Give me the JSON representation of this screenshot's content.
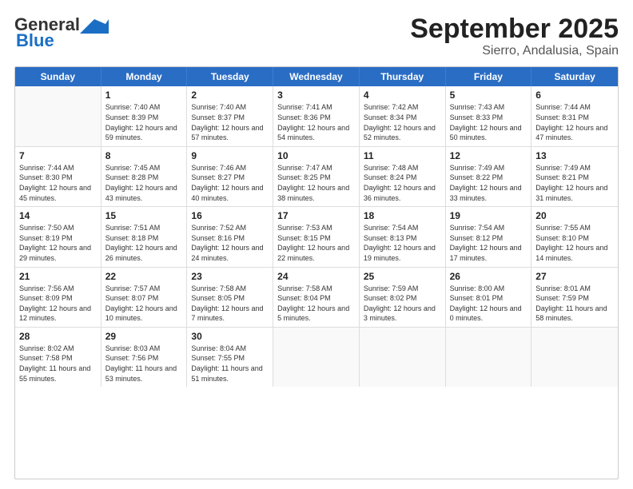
{
  "header": {
    "logo_general": "General",
    "logo_blue": "Blue",
    "title": "September 2025",
    "subtitle": "Sierro, Andalusia, Spain"
  },
  "weekdays": [
    "Sunday",
    "Monday",
    "Tuesday",
    "Wednesday",
    "Thursday",
    "Friday",
    "Saturday"
  ],
  "weeks": [
    [
      {
        "day": "",
        "sunrise": "",
        "sunset": "",
        "daylight": ""
      },
      {
        "day": "1",
        "sunrise": "Sunrise: 7:40 AM",
        "sunset": "Sunset: 8:39 PM",
        "daylight": "Daylight: 12 hours and 59 minutes."
      },
      {
        "day": "2",
        "sunrise": "Sunrise: 7:40 AM",
        "sunset": "Sunset: 8:37 PM",
        "daylight": "Daylight: 12 hours and 57 minutes."
      },
      {
        "day": "3",
        "sunrise": "Sunrise: 7:41 AM",
        "sunset": "Sunset: 8:36 PM",
        "daylight": "Daylight: 12 hours and 54 minutes."
      },
      {
        "day": "4",
        "sunrise": "Sunrise: 7:42 AM",
        "sunset": "Sunset: 8:34 PM",
        "daylight": "Daylight: 12 hours and 52 minutes."
      },
      {
        "day": "5",
        "sunrise": "Sunrise: 7:43 AM",
        "sunset": "Sunset: 8:33 PM",
        "daylight": "Daylight: 12 hours and 50 minutes."
      },
      {
        "day": "6",
        "sunrise": "Sunrise: 7:44 AM",
        "sunset": "Sunset: 8:31 PM",
        "daylight": "Daylight: 12 hours and 47 minutes."
      }
    ],
    [
      {
        "day": "7",
        "sunrise": "Sunrise: 7:44 AM",
        "sunset": "Sunset: 8:30 PM",
        "daylight": "Daylight: 12 hours and 45 minutes."
      },
      {
        "day": "8",
        "sunrise": "Sunrise: 7:45 AM",
        "sunset": "Sunset: 8:28 PM",
        "daylight": "Daylight: 12 hours and 43 minutes."
      },
      {
        "day": "9",
        "sunrise": "Sunrise: 7:46 AM",
        "sunset": "Sunset: 8:27 PM",
        "daylight": "Daylight: 12 hours and 40 minutes."
      },
      {
        "day": "10",
        "sunrise": "Sunrise: 7:47 AM",
        "sunset": "Sunset: 8:25 PM",
        "daylight": "Daylight: 12 hours and 38 minutes."
      },
      {
        "day": "11",
        "sunrise": "Sunrise: 7:48 AM",
        "sunset": "Sunset: 8:24 PM",
        "daylight": "Daylight: 12 hours and 36 minutes."
      },
      {
        "day": "12",
        "sunrise": "Sunrise: 7:49 AM",
        "sunset": "Sunset: 8:22 PM",
        "daylight": "Daylight: 12 hours and 33 minutes."
      },
      {
        "day": "13",
        "sunrise": "Sunrise: 7:49 AM",
        "sunset": "Sunset: 8:21 PM",
        "daylight": "Daylight: 12 hours and 31 minutes."
      }
    ],
    [
      {
        "day": "14",
        "sunrise": "Sunrise: 7:50 AM",
        "sunset": "Sunset: 8:19 PM",
        "daylight": "Daylight: 12 hours and 29 minutes."
      },
      {
        "day": "15",
        "sunrise": "Sunrise: 7:51 AM",
        "sunset": "Sunset: 8:18 PM",
        "daylight": "Daylight: 12 hours and 26 minutes."
      },
      {
        "day": "16",
        "sunrise": "Sunrise: 7:52 AM",
        "sunset": "Sunset: 8:16 PM",
        "daylight": "Daylight: 12 hours and 24 minutes."
      },
      {
        "day": "17",
        "sunrise": "Sunrise: 7:53 AM",
        "sunset": "Sunset: 8:15 PM",
        "daylight": "Daylight: 12 hours and 22 minutes."
      },
      {
        "day": "18",
        "sunrise": "Sunrise: 7:54 AM",
        "sunset": "Sunset: 8:13 PM",
        "daylight": "Daylight: 12 hours and 19 minutes."
      },
      {
        "day": "19",
        "sunrise": "Sunrise: 7:54 AM",
        "sunset": "Sunset: 8:12 PM",
        "daylight": "Daylight: 12 hours and 17 minutes."
      },
      {
        "day": "20",
        "sunrise": "Sunrise: 7:55 AM",
        "sunset": "Sunset: 8:10 PM",
        "daylight": "Daylight: 12 hours and 14 minutes."
      }
    ],
    [
      {
        "day": "21",
        "sunrise": "Sunrise: 7:56 AM",
        "sunset": "Sunset: 8:09 PM",
        "daylight": "Daylight: 12 hours and 12 minutes."
      },
      {
        "day": "22",
        "sunrise": "Sunrise: 7:57 AM",
        "sunset": "Sunset: 8:07 PM",
        "daylight": "Daylight: 12 hours and 10 minutes."
      },
      {
        "day": "23",
        "sunrise": "Sunrise: 7:58 AM",
        "sunset": "Sunset: 8:05 PM",
        "daylight": "Daylight: 12 hours and 7 minutes."
      },
      {
        "day": "24",
        "sunrise": "Sunrise: 7:58 AM",
        "sunset": "Sunset: 8:04 PM",
        "daylight": "Daylight: 12 hours and 5 minutes."
      },
      {
        "day": "25",
        "sunrise": "Sunrise: 7:59 AM",
        "sunset": "Sunset: 8:02 PM",
        "daylight": "Daylight: 12 hours and 3 minutes."
      },
      {
        "day": "26",
        "sunrise": "Sunrise: 8:00 AM",
        "sunset": "Sunset: 8:01 PM",
        "daylight": "Daylight: 12 hours and 0 minutes."
      },
      {
        "day": "27",
        "sunrise": "Sunrise: 8:01 AM",
        "sunset": "Sunset: 7:59 PM",
        "daylight": "Daylight: 11 hours and 58 minutes."
      }
    ],
    [
      {
        "day": "28",
        "sunrise": "Sunrise: 8:02 AM",
        "sunset": "Sunset: 7:58 PM",
        "daylight": "Daylight: 11 hours and 55 minutes."
      },
      {
        "day": "29",
        "sunrise": "Sunrise: 8:03 AM",
        "sunset": "Sunset: 7:56 PM",
        "daylight": "Daylight: 11 hours and 53 minutes."
      },
      {
        "day": "30",
        "sunrise": "Sunrise: 8:04 AM",
        "sunset": "Sunset: 7:55 PM",
        "daylight": "Daylight: 11 hours and 51 minutes."
      },
      {
        "day": "",
        "sunrise": "",
        "sunset": "",
        "daylight": ""
      },
      {
        "day": "",
        "sunrise": "",
        "sunset": "",
        "daylight": ""
      },
      {
        "day": "",
        "sunrise": "",
        "sunset": "",
        "daylight": ""
      },
      {
        "day": "",
        "sunrise": "",
        "sunset": "",
        "daylight": ""
      }
    ]
  ]
}
